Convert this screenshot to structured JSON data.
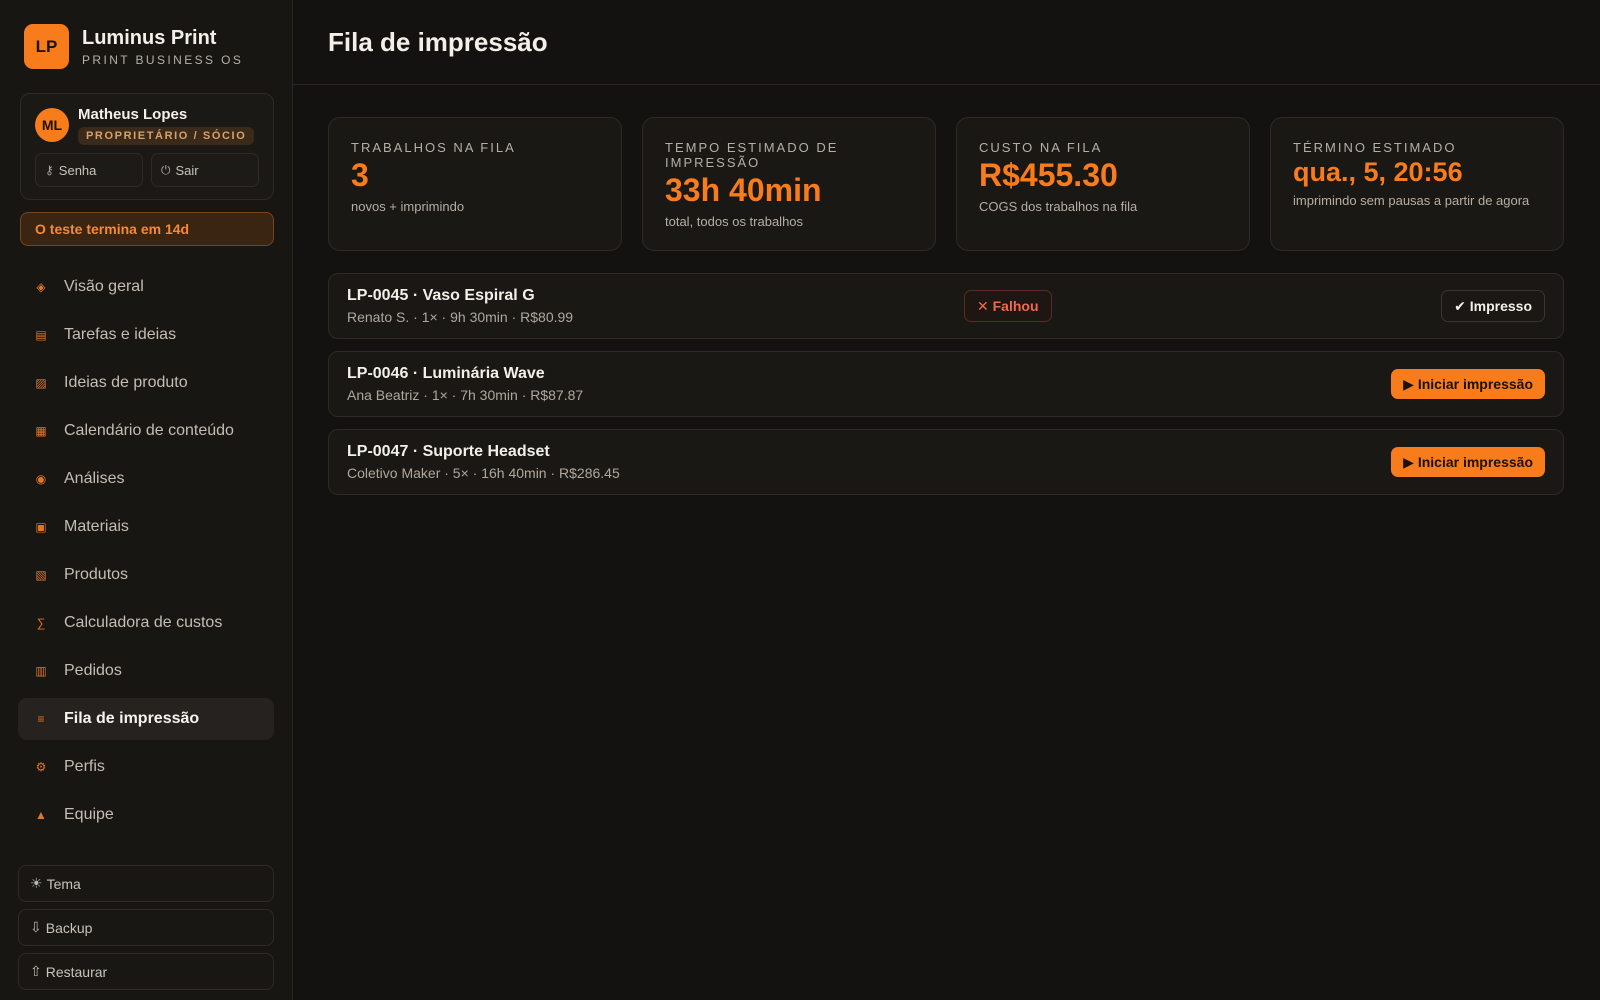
{
  "brand": {
    "logo_text": "LP",
    "name": "Luminus Print",
    "subtitle": "PRINT BUSINESS OS"
  },
  "user": {
    "initials": "ML",
    "name": "Matheus Lopes",
    "role": "PROPRIETÁRIO / SÓCIO",
    "password_label": "Senha",
    "logout_label": "Sair"
  },
  "trial_text": "O teste termina em 14d",
  "nav": [
    {
      "label": "Visão geral",
      "icon": "diamond-icon",
      "glyph": "◈"
    },
    {
      "label": "Tarefas e ideias",
      "icon": "list-icon",
      "glyph": "▤"
    },
    {
      "label": "Ideias de produto",
      "icon": "grid-icon",
      "glyph": "▨"
    },
    {
      "label": "Calendário de conteúdo",
      "icon": "calendar-icon",
      "glyph": "▦"
    },
    {
      "label": "Análises",
      "icon": "chart-icon",
      "glyph": "◉"
    },
    {
      "label": "Materiais",
      "icon": "material-icon",
      "glyph": "▣"
    },
    {
      "label": "Produtos",
      "icon": "box-icon",
      "glyph": "▧"
    },
    {
      "label": "Calculadora de custos",
      "icon": "sum-icon",
      "glyph": "∑"
    },
    {
      "label": "Pedidos",
      "icon": "orders-icon",
      "glyph": "▥"
    },
    {
      "label": "Fila de impressão",
      "icon": "queue-icon",
      "glyph": "≡",
      "active": true
    },
    {
      "label": "Perfis",
      "icon": "gear-icon",
      "glyph": "⚙"
    },
    {
      "label": "Equipe",
      "icon": "team-icon",
      "glyph": "▲"
    }
  ],
  "bottom": {
    "theme_label": "Tema",
    "backup_label": "Backup",
    "restore_label": "Restaurar"
  },
  "page_title": "Fila de impressão",
  "stats": [
    {
      "label": "TRABALHOS NA FILA",
      "value": "3",
      "sub": "novos + imprimindo"
    },
    {
      "label": "TEMPO ESTIMADO DE IMPRESSÃO",
      "value": "33h 40min",
      "sub": "total, todos os trabalhos"
    },
    {
      "label": "CUSTO NA FILA",
      "value": "R$455.30",
      "sub": "COGS dos trabalhos na fila"
    },
    {
      "label": "TÉRMINO ESTIMADO",
      "value": "qua., 5, 20:56",
      "sub": "imprimindo sem pausas a partir de agora"
    }
  ],
  "jobs": [
    {
      "title": "LP-0045 · Vaso Espiral G",
      "meta": "Renato S. · 1× · 9h 30min · R$80.99",
      "status": "✕ Falhou",
      "action": "✔ Impresso"
    },
    {
      "title": "LP-0046 · Luminária Wave",
      "meta": "Ana Beatriz · 1× · 7h 30min · R$87.87",
      "action": "▶ Iniciar impressão"
    },
    {
      "title": "LP-0047 · Suporte Headset",
      "meta": "Coletivo Maker · 5× · 16h 40min · R$286.45",
      "action": "▶ Iniciar impressão"
    }
  ]
}
